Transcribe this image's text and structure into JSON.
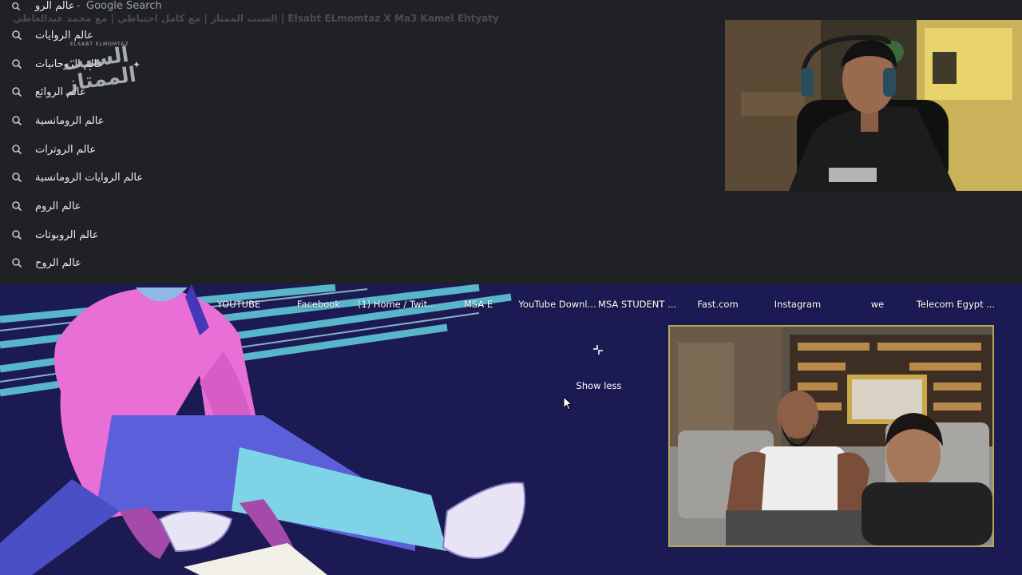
{
  "search": {
    "query": "عالم الرو",
    "separator": "-",
    "provider": "Google Search",
    "background_title": "السبت الممتاز | مع كامل احتياطي | مع محمد عبدالعاطي | Elsabt ELmomtaz X Ma3 Kamel Ehtyaty"
  },
  "suggestions": [
    "عالم الروايات",
    "عالم الروحانيات",
    "عالم الروائع",
    "عالم الرومانسية",
    "عالم الروترات",
    "عالم الروايات الرومانسية",
    "عالم الروم",
    "عالم الروبوتات",
    "عالم الروح"
  ],
  "watermark": {
    "small_text": "ELSABT ELMOMTAZ",
    "big_text": "السبت الممتاز"
  },
  "shortcuts": [
    "YOUTUBE",
    "Facebook",
    "(1) Home / Twit...",
    "MSA E",
    "YouTube Downl...",
    "MSA STUDENT ...",
    "Fast.com",
    "Instagram",
    "we",
    "Telecom Egypt ..."
  ],
  "show_less": {
    "label": "Show less",
    "icon": "collapse-icon"
  },
  "colors": {
    "dropdown_bg": "#202124",
    "page_bg": "#1c1a52",
    "guest_border": "#b5a55b"
  }
}
